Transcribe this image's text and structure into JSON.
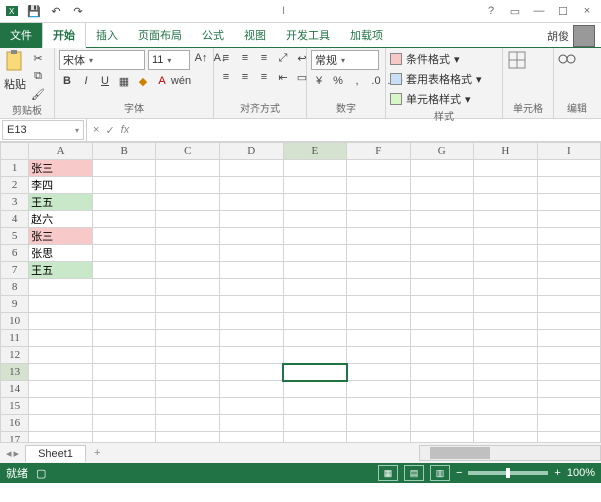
{
  "titlebar": {
    "app_initial": "I"
  },
  "tabs": {
    "file": "文件",
    "home": "开始",
    "insert": "插入",
    "layout": "页面布局",
    "formulas": "公式",
    "view": "视图",
    "dev": "开发工具",
    "addins": "加载项",
    "user": "胡俊"
  },
  "ribbon": {
    "clipboard": {
      "label": "剪贴板",
      "paste": "粘贴"
    },
    "font": {
      "label": "字体",
      "name": "宋体",
      "size": "11",
      "ruby": "wén"
    },
    "align": {
      "label": "对齐方式"
    },
    "number": {
      "label": "数字",
      "format": "常规"
    },
    "styles": {
      "label": "样式",
      "cond": "条件格式",
      "tbl": "套用表格格式",
      "cell": "单元格样式"
    },
    "cells": {
      "label": "单元格"
    },
    "editing": {
      "label": "编辑"
    }
  },
  "namebox": {
    "ref": "E13"
  },
  "grid": {
    "cols": [
      "A",
      "B",
      "C",
      "D",
      "E",
      "F",
      "G",
      "H",
      "I"
    ],
    "rows": 18,
    "data": {
      "1": {
        "A": {
          "t": "张三",
          "c": "hl-red"
        }
      },
      "2": {
        "A": {
          "t": "李四"
        }
      },
      "3": {
        "A": {
          "t": "王五",
          "c": "hl-grn"
        }
      },
      "4": {
        "A": {
          "t": "赵六"
        }
      },
      "5": {
        "A": {
          "t": "张三",
          "c": "hl-red"
        }
      },
      "6": {
        "A": {
          "t": "张思"
        }
      },
      "7": {
        "A": {
          "t": "王五",
          "c": "hl-grn"
        }
      }
    },
    "active": {
      "row": 13,
      "col": "E"
    }
  },
  "sheetbar": {
    "sheet": "Sheet1",
    "add": "+"
  },
  "status": {
    "ready": "就绪",
    "zoom": "100%"
  }
}
